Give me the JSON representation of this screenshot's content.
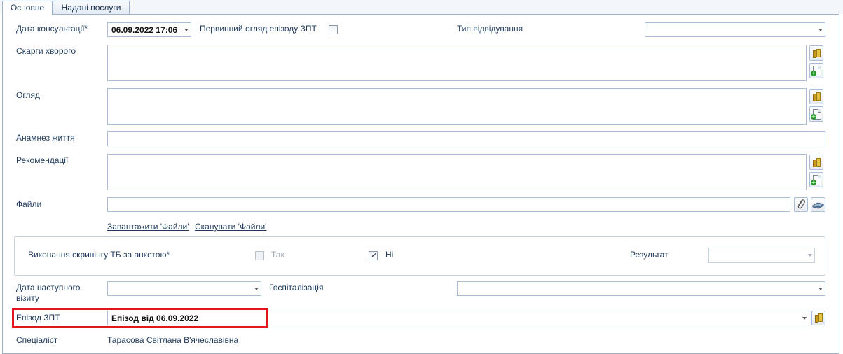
{
  "tabs": [
    {
      "label": "Основне",
      "active": true
    },
    {
      "label": "Надані послуги",
      "active": false
    }
  ],
  "form": {
    "consult_date_label": "Дата консультації*",
    "consult_date_value": "06.09.2022 17:06",
    "primary_exam_label": "Первинний огляд епізоду ЗПТ",
    "primary_exam_checked": false,
    "visit_type_label": "Тип відвідування",
    "visit_type_value": "",
    "complaints_label": "Скарги хворого",
    "complaints_value": "",
    "exam_label": "Огляд",
    "exam_value": "",
    "anamnesis_label": "Анамнез життя",
    "anamnesis_value": "",
    "recommendations_label": "Рекомендації",
    "recommendations_value": "",
    "files_label": "Файли",
    "files_value": "",
    "upload_files_link": "Завантажити 'Файли'",
    "scan_files_link": "Сканувати 'Файли'",
    "tb_screening_label": "Виконання скринінгу ТБ за анкетою*",
    "tb_yes_label": "Так",
    "tb_yes_checked": false,
    "tb_no_label": "Ні",
    "tb_no_checked": true,
    "result_label": "Результат",
    "result_value": "",
    "next_visit_label": "Дата наступного візиту",
    "next_visit_value": "",
    "hospitalization_label": "Госпіталізація",
    "hospitalization_value": "",
    "episode_label": "Епізод ЗПТ",
    "episode_value": "Епізод від 06.09.2022",
    "specialist_label": "Спеціаліст",
    "specialist_value": "Тарасова Світлана В'ячеславівна"
  },
  "icons": {
    "dictionary": "book-icon",
    "add_template": "document-add-icon",
    "attach": "paperclip-icon",
    "scan": "scanner-icon"
  },
  "colors": {
    "label_text": "#1e395b",
    "input_border": "#a8bedb",
    "highlight": "#e3151c"
  }
}
